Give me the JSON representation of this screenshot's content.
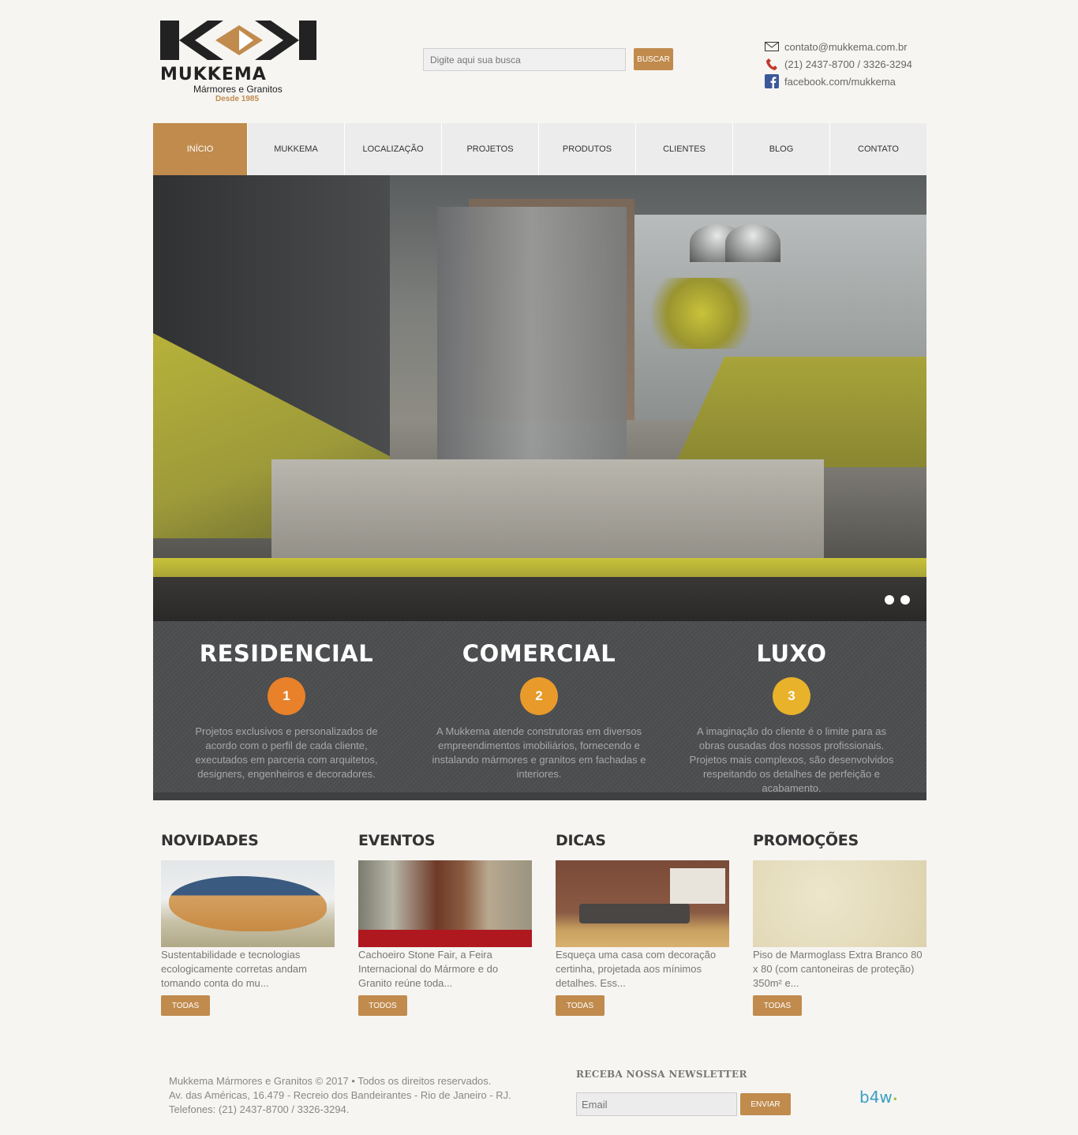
{
  "brand": {
    "name": "MUKKEMA",
    "tagline": "Mármores e Granitos",
    "since": "Desde 1985",
    "accent_color": "#c08b4d"
  },
  "search": {
    "placeholder": "Digite aqui sua busca",
    "button_label": "BUSCAR"
  },
  "contact": {
    "email": "contato@mukkema.com.br",
    "phone": "(21) 2437-8700 / 3326-3294",
    "facebook": "facebook.com/mukkema",
    "icons": [
      "mail-icon",
      "phone-icon",
      "facebook-icon"
    ]
  },
  "nav": {
    "items": [
      {
        "label": "INÍCIO",
        "active": true
      },
      {
        "label": "MUKKEMA"
      },
      {
        "label": "LOCALIZAÇÃO"
      },
      {
        "label": "PROJETOS"
      },
      {
        "label": "PRODUTOS"
      },
      {
        "label": "CLIENTES"
      },
      {
        "label": "BLOG"
      },
      {
        "label": "CONTATO"
      }
    ]
  },
  "slider": {
    "slide_count": 2
  },
  "features": [
    {
      "title": "RESIDENCIAL",
      "number": "1",
      "color": "#e8812a",
      "text": "Projetos exclusivos e personalizados de acordo com o perfil de cada cliente, executados em parceria com arquitetos, designers, engenheiros e decoradores."
    },
    {
      "title": "COMERCIAL",
      "number": "2",
      "color": "#e89a2a",
      "text": "A Mukkema atende construtoras em diversos empreendimentos imobiliários, fornecendo e instalando mármores e granitos em fachadas e interiores."
    },
    {
      "title": "LUXO",
      "number": "3",
      "color": "#e8b22a",
      "text": "A imaginação do cliente é o limite para as obras ousadas dos nossos profissionais. Projetos mais complexos, são desenvolvidos respeitando os detalhes de perfeição e acabamento."
    }
  ],
  "news": [
    {
      "title": "NOVIDADES",
      "text": "Sustentabilidade e tecnologias ecologicamente corretas andam tomando conta do mu...",
      "button": "TODAS"
    },
    {
      "title": "EVENTOS",
      "text": "Cachoeiro Stone Fair, a Feira Internacional do Mármore e do Granito reúne toda...",
      "button": "TODOS"
    },
    {
      "title": "DICAS",
      "text": "Esqueça uma casa com decoração certinha, projetada aos mínimos detalhes. Ess...",
      "button": "TODAS"
    },
    {
      "title": "PROMOÇÕES",
      "text": "Piso de Marmoglass Extra Branco 80 x 80 (com cantoneiras de proteção) 350m² e...",
      "button": "TODAS"
    }
  ],
  "footer": {
    "line1": "Mukkema Mármores e Granitos © 2017 • Todos os direitos reservados.",
    "line2": "Av. das Américas, 16.479 - Recreio dos Bandeirantes - Rio de Janeiro - RJ.",
    "line3": "Telefones: (21) 2437-8700 / 3326-3294.",
    "newsletter_title": "RECEBA NOSSA NEWSLETTER",
    "newsletter_placeholder": "Email",
    "newsletter_button": "ENVIAR",
    "credit": "b4w"
  }
}
